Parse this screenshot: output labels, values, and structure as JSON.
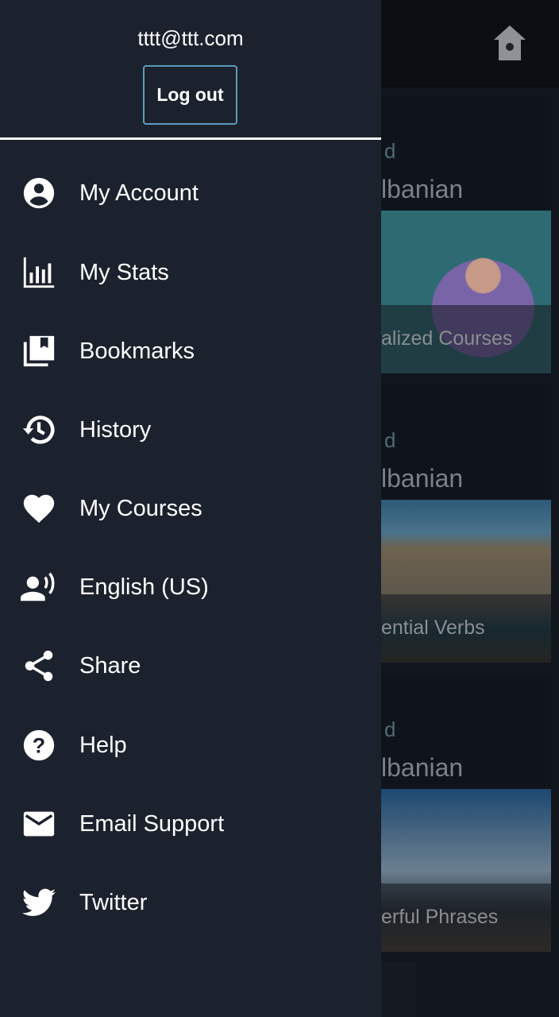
{
  "header": {
    "icon": "home-icon"
  },
  "cards": [
    {
      "subtitle": "d",
      "title": "lbanian",
      "caption": "alized Courses"
    },
    {
      "subtitle": "d",
      "title": "lbanian",
      "caption": "ential Verbs"
    },
    {
      "subtitle": "d",
      "title": "lbanian",
      "caption": "erful Phrases"
    }
  ],
  "drawer": {
    "email": "tttt@ttt.com",
    "logout_label": "Log out",
    "items": [
      {
        "label": "My Account",
        "icon": "account-circle-icon"
      },
      {
        "label": "My Stats",
        "icon": "bar-chart-icon"
      },
      {
        "label": "Bookmarks",
        "icon": "bookmarks-icon"
      },
      {
        "label": "History",
        "icon": "history-icon"
      },
      {
        "label": "My Courses",
        "icon": "heart-icon"
      },
      {
        "label": "English (US)",
        "icon": "voice-icon"
      },
      {
        "label": "Share",
        "icon": "share-icon"
      },
      {
        "label": "Help",
        "icon": "help-icon"
      },
      {
        "label": "Email Support",
        "icon": "email-icon"
      },
      {
        "label": "Twitter",
        "icon": "twitter-icon"
      }
    ]
  }
}
